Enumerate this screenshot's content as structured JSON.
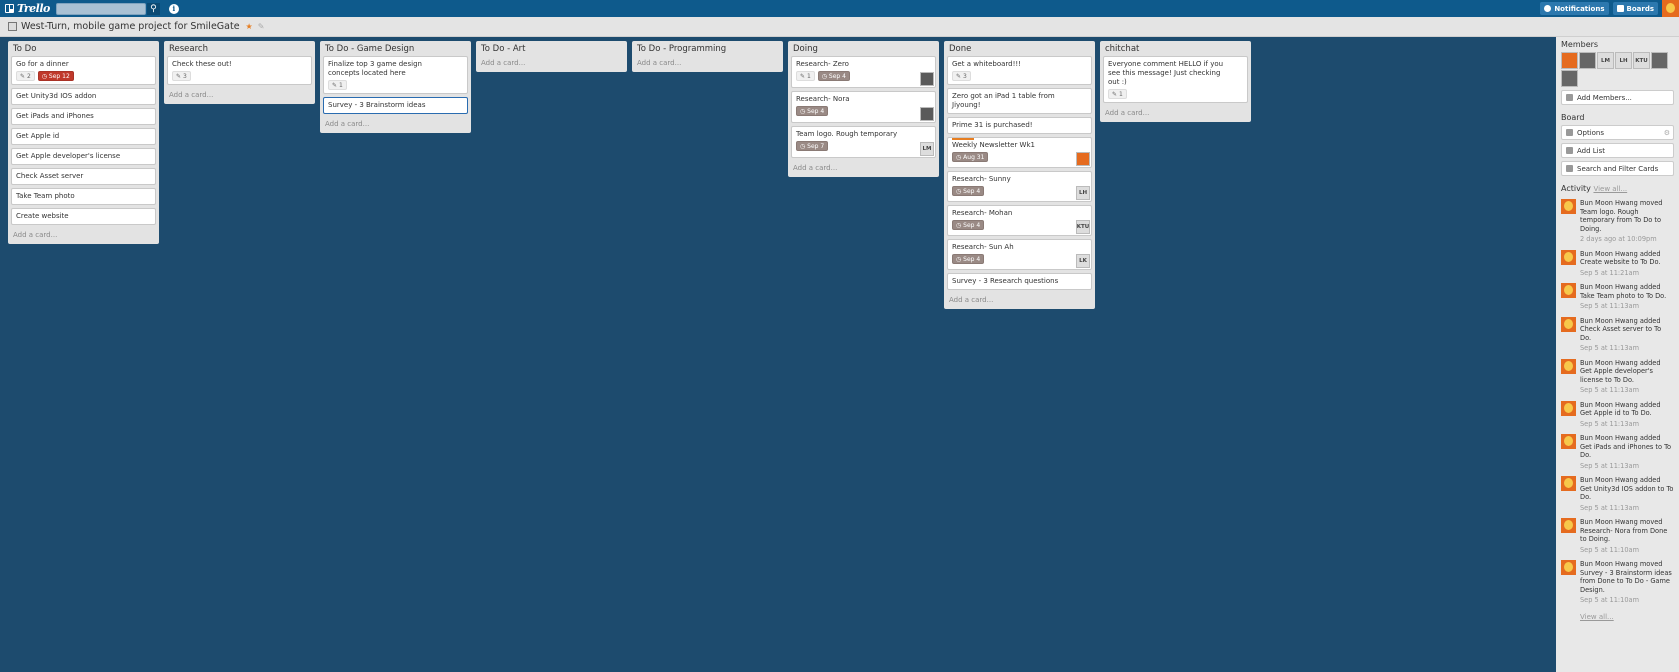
{
  "topbar": {
    "logo": "Trello",
    "search_placeholder": "",
    "notifications": "Notifications",
    "boards": "Boards"
  },
  "board": {
    "title": "West-Turn, mobile game project for SmileGate"
  },
  "lists": [
    {
      "title": "To Do",
      "add": "Add a card...",
      "cards": [
        {
          "text": "Go for a dinner",
          "comments": "2",
          "due": "Sep 12"
        },
        {
          "text": "Get Unity3d IOS addon"
        },
        {
          "text": "Get iPads and iPhones"
        },
        {
          "text": "Get Apple id"
        },
        {
          "text": "Get Apple developer's license"
        },
        {
          "text": "Check Asset server"
        },
        {
          "text": "Take Team photo"
        },
        {
          "text": "Create website"
        }
      ]
    },
    {
      "title": "Research",
      "add": "Add a card...",
      "cards": [
        {
          "text": "Check these out!",
          "comments": "3"
        }
      ]
    },
    {
      "title": "To Do - Game Design",
      "add": "Add a card...",
      "cards": [
        {
          "text": "Finalize top 3 game design concepts located here",
          "comments": "1"
        },
        {
          "text": "Survey - 3 Brainstorm ideas"
        }
      ]
    },
    {
      "title": "To Do - Art",
      "add": "Add a card...",
      "cards": []
    },
    {
      "title": "To Do - Programming",
      "add": "Add a card...",
      "cards": []
    },
    {
      "title": "Doing",
      "add": "Add a card...",
      "cards": [
        {
          "text": "Research- Zero",
          "comments": "1",
          "due": "Sep 4"
        },
        {
          "text": "Research- Nora",
          "due": "Sep 4"
        },
        {
          "text": "Team logo. Rough temporary",
          "due": "Sep 7",
          "member": "LM"
        }
      ]
    },
    {
      "title": "Done",
      "add": "Add a card...",
      "cards": [
        {
          "text": "Get a whiteboard!!!",
          "comments": "3"
        },
        {
          "text": "Zero got an iPad 1 table from Jiyoung!"
        },
        {
          "text": "Prime 31 is purchased!"
        },
        {
          "text": "Weekly Newsletter Wk1",
          "due": "Aug 31"
        },
        {
          "text": "Research- Sunny",
          "due": "Sep 4",
          "member": "LH"
        },
        {
          "text": "Research- Mohan",
          "due": "Sep 4",
          "member": "KTU"
        },
        {
          "text": "Research- Sun Ah",
          "due": "Sep 4",
          "member": "LK"
        },
        {
          "text": "Survey - 3 Research questions"
        }
      ]
    },
    {
      "title": "chitchat",
      "add": "Add a card...",
      "cards": [
        {
          "text": "Everyone comment HELLO if you see this message! Just checking out :)",
          "comments": "1"
        }
      ]
    }
  ],
  "sidebar": {
    "members_title": "Members",
    "member_initials": [
      "LM",
      "LH",
      "KTU"
    ],
    "add_members": "Add Members...",
    "board_title": "Board",
    "options": "Options",
    "add_list": "Add List",
    "search_filter": "Search and Filter Cards",
    "activity_title": "Activity",
    "view_all_top": "View all...",
    "view_all_bottom": "View all...",
    "activity": [
      {
        "text": "Bun Moon Hwang moved Team logo. Rough temporary from To Do to Doing.",
        "time": "2 days ago at 10:09pm"
      },
      {
        "text": "Bun Moon Hwang added Create website to To Do.",
        "time": "Sep 5 at 11:21am"
      },
      {
        "text": "Bun Moon Hwang added Take Team photo to To Do.",
        "time": "Sep 5 at 11:13am"
      },
      {
        "text": "Bun Moon Hwang added Check Asset server to To Do.",
        "time": "Sep 5 at 11:13am"
      },
      {
        "text": "Bun Moon Hwang added Get Apple developer's license to To Do.",
        "time": "Sep 5 at 11:13am"
      },
      {
        "text": "Bun Moon Hwang added Get Apple id to To Do.",
        "time": "Sep 5 at 11:13am"
      },
      {
        "text": "Bun Moon Hwang added Get iPads and iPhones to To Do.",
        "time": "Sep 5 at 11:13am"
      },
      {
        "text": "Bun Moon Hwang added Get Unity3d IOS addon to To Do.",
        "time": "Sep 5 at 11:13am"
      },
      {
        "text": "Bun Moon Hwang moved Research- Nora from Done to Doing.",
        "time": "Sep 5 at 11:10am"
      },
      {
        "text": "Bun Moon Hwang moved Survey - 3 Brainstorm ideas from Done to To Do - Game Design.",
        "time": "Sep 5 at 11:10am"
      }
    ]
  }
}
